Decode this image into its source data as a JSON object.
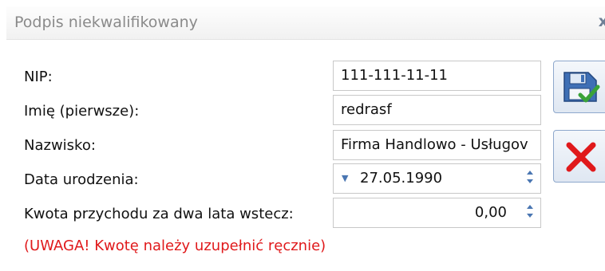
{
  "window": {
    "title": "Podpis niekwalifikowany",
    "close_label": "x"
  },
  "form": {
    "nip_label": "NIP:",
    "nip_value": "111-111-11-11",
    "first_name_label": "Imię (pierwsze):",
    "first_name_value": "redrasf",
    "last_name_label": "Nazwisko:",
    "last_name_value": "Firma Handlowo - Usługov",
    "birth_date_label": "Data urodzenia:",
    "birth_date_value": "27.05.1990",
    "income_label": "Kwota przychodu za dwa lata wstecz:",
    "income_value": "0,00",
    "warning": "(UWAGA! Kwotę należy uzupełnić ręcznie)"
  },
  "icons": {
    "save": "save-disk-icon",
    "cancel": "cancel-x-icon",
    "date_dropdown": "chevron-down-icon",
    "spin": "spin-arrows-icon"
  },
  "colors": {
    "warning": "#e0191b",
    "accent": "#4a76b2",
    "cancel": "#e0191b",
    "check": "#3aa339"
  }
}
